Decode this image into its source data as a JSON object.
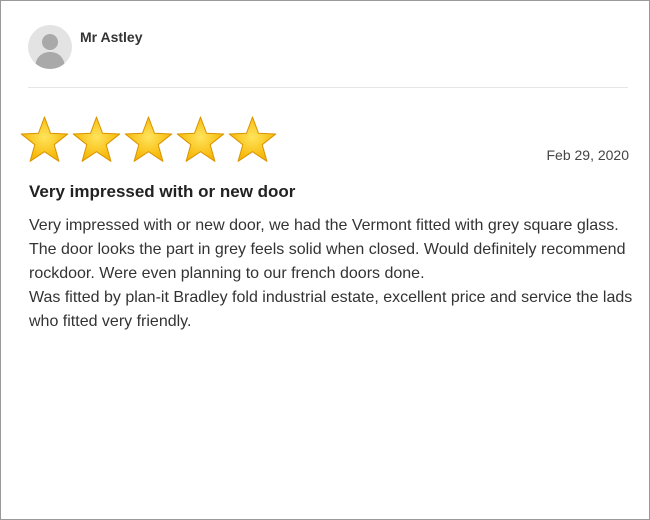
{
  "review": {
    "reviewer_name": "Mr Astley",
    "rating": 5,
    "rating_max": 5,
    "date": "Feb 29, 2020",
    "title": "Very impressed with or new door",
    "paragraphs": [
      "Very impressed with or new door, we had the Vermont fitted with grey square glass. The door looks the part in grey feels solid when closed. Would definitely recommend rockdoor. Were even planning to our french doors done.",
      "Was fitted by plan-it Bradley fold industrial estate, excellent price and service the lads who fitted very friendly."
    ]
  },
  "icons": {
    "avatar": "user-silhouette-icon",
    "star": "star-icon"
  },
  "colors": {
    "star_fill": "#f6b400",
    "star_highlight": "#ffe45c",
    "avatar_bg": "#e3e3e3",
    "avatar_figure": "#a9a9a9"
  }
}
